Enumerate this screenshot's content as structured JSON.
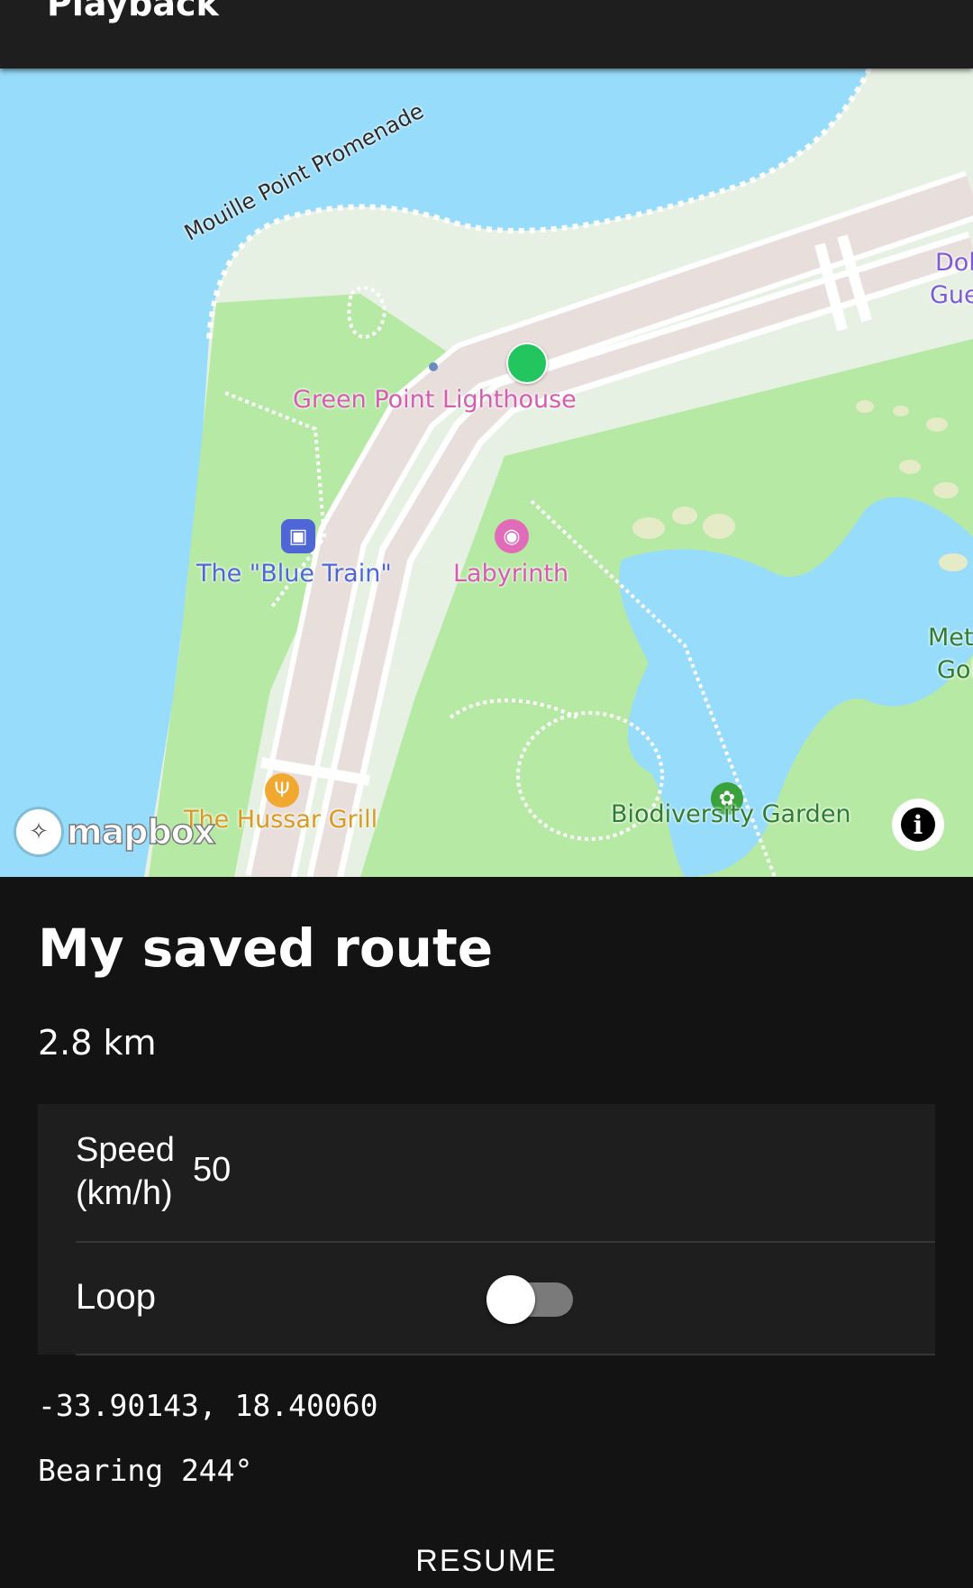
{
  "app_bar": {
    "title": "Playback"
  },
  "map": {
    "street_label": "Mouille Point Promenade",
    "pois": {
      "lighthouse": "Green Point Lighthouse",
      "blue_train": "The \"Blue Train\"",
      "labyrinth": "Labyrinth",
      "hussar_grill": "The Hussar Grill",
      "biodiversity_garden": "Biodiversity Garden",
      "dolphin_partial": "Dol",
      "guest_partial": "Gue",
      "met_partial": "Met",
      "golf_partial": "Gol"
    },
    "attribution": "mapbox",
    "info_symbol": "i",
    "colors": {
      "water": "#98dcfb",
      "park": "#b6e9a4",
      "land": "#e6f1e3",
      "road": "#ffffff",
      "blocks": "#e8dfdc",
      "marker": "#22c55e"
    }
  },
  "route": {
    "name": "My saved route",
    "distance": "2.8 km"
  },
  "settings": {
    "speed_label": "Speed (km/h)",
    "speed_value": "50",
    "loop_label": "Loop",
    "loop_enabled": false
  },
  "position": {
    "coordinates": "-33.90143, 18.40060",
    "bearing": "Bearing 244°"
  },
  "actions": {
    "resume_label": "RESUME"
  }
}
